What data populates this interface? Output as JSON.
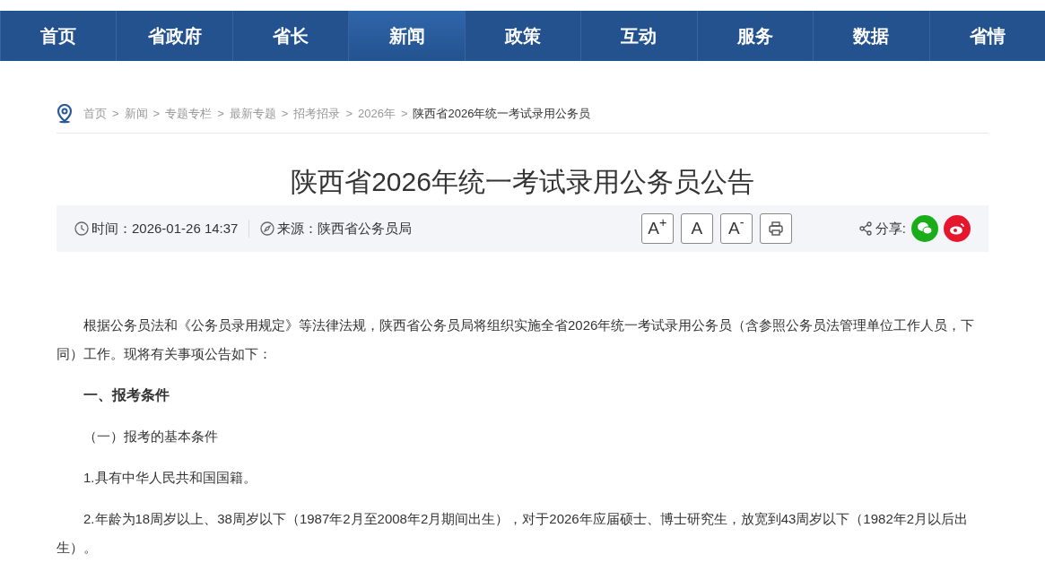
{
  "nav": [
    {
      "label": "首页",
      "selected": false
    },
    {
      "label": "省政府",
      "selected": false
    },
    {
      "label": "省长",
      "selected": false
    },
    {
      "label": "新闻",
      "selected": true
    },
    {
      "label": "政策",
      "selected": false
    },
    {
      "label": "互动",
      "selected": false
    },
    {
      "label": "服务",
      "selected": false
    },
    {
      "label": "数据",
      "selected": false
    },
    {
      "label": "省情",
      "selected": false
    }
  ],
  "breadcrumb": [
    {
      "label": "首页",
      "selected": false
    },
    {
      "label": "新闻",
      "selected": false
    },
    {
      "label": "专题专栏",
      "selected": false
    },
    {
      "label": "最新专题",
      "selected": false
    },
    {
      "label": "招考招录",
      "selected": false
    },
    {
      "label": "2026年",
      "selected": false
    },
    {
      "label": "陕西省2026年统一考试录用公务员",
      "selected": true
    }
  ],
  "breadcrumb_separator": ">",
  "title": "陕西省2026年统一考试录用公务员公告",
  "meta": {
    "time": "时间：2026-01-26 14:37",
    "source": "来源：陕西省公务员局"
  },
  "font_buttons": [
    "A$^{+}$",
    "A",
    "A$^{-}$"
  ],
  "share_label": "分享:",
  "paragraphs": [
    {
      "kind": "text",
      "text": "根据公务员法和《公务员录用规定》等法律法规，陕西省公务员局将组织实施全省2026年统一考试录用公务员（含参照公务员法管理单位工作人员，下同）工作。现将有关事项公告如下："
    },
    {
      "kind": "heading",
      "text": "一、报考条件"
    },
    {
      "kind": "text",
      "text": "（一）报考的基本条件"
    },
    {
      "kind": "text",
      "text": "1.具有中华人民共和国国籍。"
    },
    {
      "kind": "text",
      "text": "2.年龄为18周岁以上、38周岁以下（1987年2月至2008年2月期间出生），对于2026年应届硕士、博士研究生，放宽到43周岁以下（1982年2月以后出生）。"
    }
  ]
}
